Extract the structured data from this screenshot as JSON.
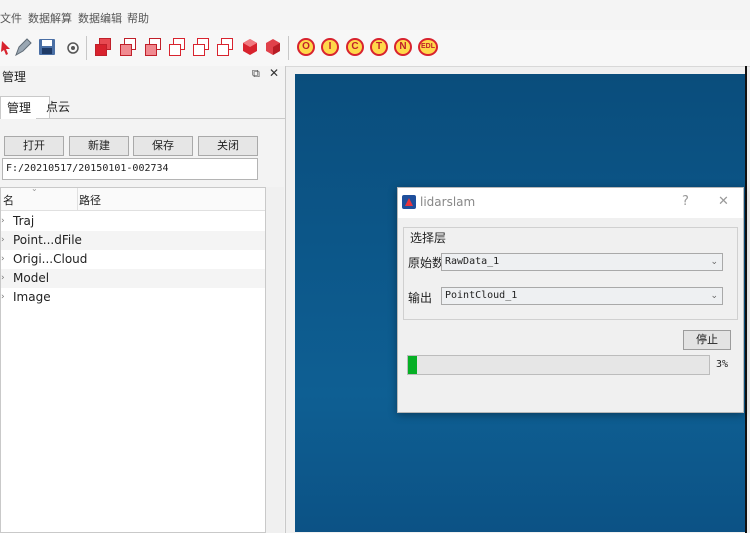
{
  "menu": [
    "文件",
    "数据解算",
    "数据编辑",
    "帮助"
  ],
  "toolbar": {
    "view_icons": [
      "cube-front-icon",
      "cube-back-icon",
      "cube-left-icon",
      "cube-right-icon",
      "cube-top-icon",
      "cube-bottom-icon",
      "cube-iso-icon",
      "cube-iso-2-icon"
    ],
    "mode_buttons": [
      "O",
      "I",
      "C",
      "T",
      "N",
      "EDL"
    ],
    "accent": "#d8232e"
  },
  "panel": {
    "title": "管理",
    "tabs": [
      "管理",
      "点云"
    ],
    "buttons": [
      "打开",
      "新建",
      "保存",
      "关闭"
    ],
    "path_value": "F:/20210517/20150101-002734",
    "tree_headers": [
      "名",
      "路径"
    ],
    "tree_items": [
      "Traj",
      "Point...dFile",
      "Origi...Cloud",
      "Model",
      "Image"
    ]
  },
  "dialog": {
    "title": "lidarslam",
    "help": "?",
    "close": "✕",
    "group_title": "选择层",
    "input_label": "原始数据",
    "input_value": "RawData_1",
    "output_label": "输出",
    "output_value": "PointCloud_1",
    "stop_label": "停止",
    "progress_percent": 3,
    "progress_text": "3%"
  },
  "colors": {
    "viewport_top": "#0a4d7c",
    "viewport_bottom": "#0c5285",
    "progress_green": "#06b025"
  }
}
